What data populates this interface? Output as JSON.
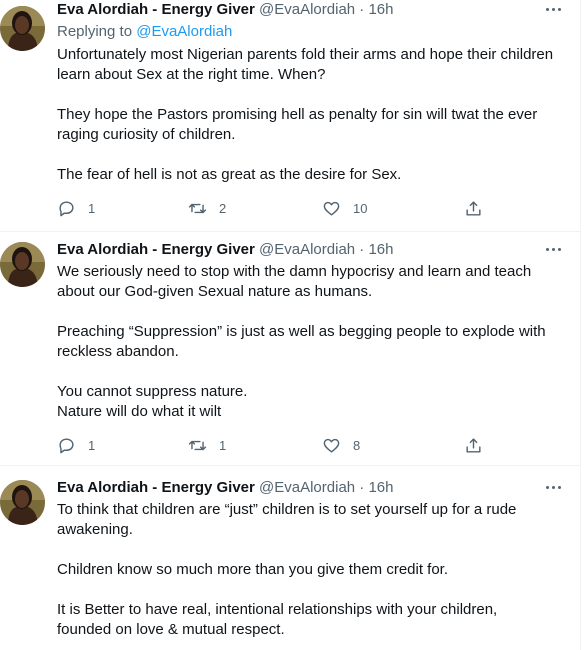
{
  "tweets": [
    {
      "name": "Eva Alordiah - Energy Giver",
      "handle": "@EvaAlordiah",
      "separator": "·",
      "time": "16h",
      "replying_prefix": "Replying to",
      "replying_to": "@EvaAlordiah",
      "paragraphs": [
        [
          "Unfortunately most Nigerian parents fold their arms and hope their children",
          "learn about Sex at the right time. When?"
        ],
        [
          "They hope the Pastors promising hell as penalty for sin will twat the ever",
          "raging curiosity of children."
        ],
        [
          "The fear of hell is not as great as the desire for Sex."
        ]
      ],
      "replies": "1",
      "retweets": "2",
      "likes": "10"
    },
    {
      "name": "Eva Alordiah - Energy Giver",
      "handle": "@EvaAlordiah",
      "separator": "·",
      "time": "16h",
      "paragraphs": [
        [
          "We seriously need to stop with the damn hypocrisy and learn and teach",
          "about our God-given Sexual nature as humans."
        ],
        [
          "Preaching “Suppression” is just as well as begging people to explode with",
          "reckless abandon."
        ],
        [
          "You cannot suppress nature.",
          "Nature will do what it wilt"
        ]
      ],
      "replies": "1",
      "retweets": "1",
      "likes": "8"
    },
    {
      "name": "Eva Alordiah - Energy Giver",
      "handle": "@EvaAlordiah",
      "separator": "·",
      "time": "16h",
      "paragraphs": [
        [
          "To think that children are “just” children is to set yourself up for a rude",
          "awakening."
        ],
        [
          "Children know so much more than you give them credit for."
        ],
        [
          "It is Better to have real, intentional relationships with your children,",
          "founded on love & mutual respect."
        ]
      ]
    }
  ],
  "colors": {
    "text": "#0f1419",
    "secondary": "#536471",
    "link": "#1d9bf0",
    "divider": "#eff3f4"
  },
  "icons": [
    "avatar-photo",
    "more-icon",
    "reply-icon",
    "retweet-icon",
    "like-icon",
    "share-icon"
  ]
}
